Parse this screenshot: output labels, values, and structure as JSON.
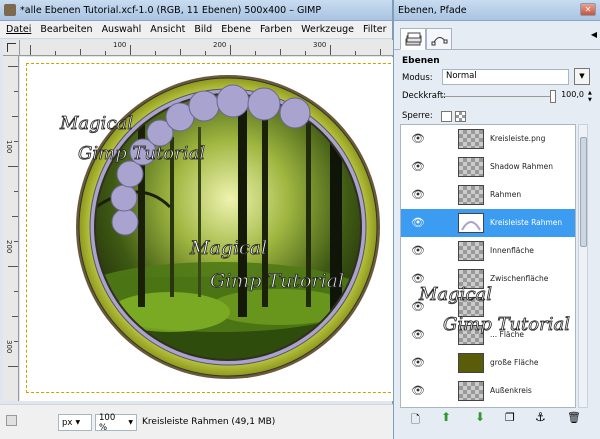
{
  "main_window": {
    "title": "*alle Ebenen Tutorial.xcf-1.0 (RGB, 11 Ebenen) 500x400 – GIMP",
    "menu": [
      "Datei",
      "Bearbeiten",
      "Auswahl",
      "Ansicht",
      "Bild",
      "Ebene",
      "Farben",
      "Werkzeuge",
      "Filter"
    ],
    "ruler_h_labels": [
      "100",
      "200",
      "300"
    ],
    "ruler_v_labels": [
      "100",
      "200",
      "300"
    ],
    "status": {
      "unit": "px",
      "zoom": "100 %",
      "text": "Kreisleiste Rahmen (49,1 MB)"
    },
    "watermark": [
      "Magical",
      "Gimp Tutorial"
    ]
  },
  "dock": {
    "title": "Ebenen, Pfade",
    "section": "Ebenen",
    "mode_label": "Modus:",
    "mode_value": "Normal",
    "opacity_label": "Deckkraft:",
    "opacity_value": "100,0",
    "opacity_level": 100,
    "lock_label": "Sperre:",
    "layers": [
      {
        "name": "Kreisleiste.png",
        "selected": false
      },
      {
        "name": "Shadow Rahmen",
        "selected": false
      },
      {
        "name": "Rahmen",
        "selected": false
      },
      {
        "name": "Kreisleiste Rahmen",
        "selected": true
      },
      {
        "name": "Innenfläche",
        "selected": false
      },
      {
        "name": "Zwischenfläche",
        "selected": false
      },
      {
        "name": "",
        "selected": false
      },
      {
        "name": "... Fläche",
        "selected": false
      },
      {
        "name": "große Fläche",
        "selected": false
      },
      {
        "name": "Außenkreis",
        "selected": false
      }
    ],
    "colors": {
      "selection": "#3c9cf2",
      "ring": "#c7cf2d",
      "beads": "#a9a3cf"
    }
  }
}
